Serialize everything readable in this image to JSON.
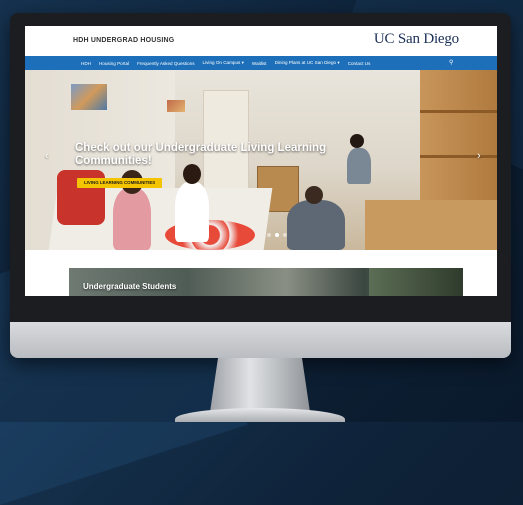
{
  "header": {
    "site_title": "HDH UNDERGRAD HOUSING",
    "brand": "UC San Diego"
  },
  "nav": {
    "items": [
      "HDH",
      "Housing Portal",
      "Frequently Asked Questions",
      "Living On Campus ▾",
      "Waitlist",
      "Dining Plans at UC San Diego ▾",
      "Contact Us"
    ],
    "search_icon": "search-icon"
  },
  "hero": {
    "title": "Check out our Undergraduate Living Learning Communities!",
    "button_label": "LIVING LEARNING COMMUNITIES",
    "active_slide": 2,
    "slide_count": 3
  },
  "feature": {
    "title": "Undergraduate Students"
  },
  "colors": {
    "nav_blue": "#1c6fb8",
    "button_yellow": "#f5c400",
    "brand_navy": "#1a2f55"
  }
}
